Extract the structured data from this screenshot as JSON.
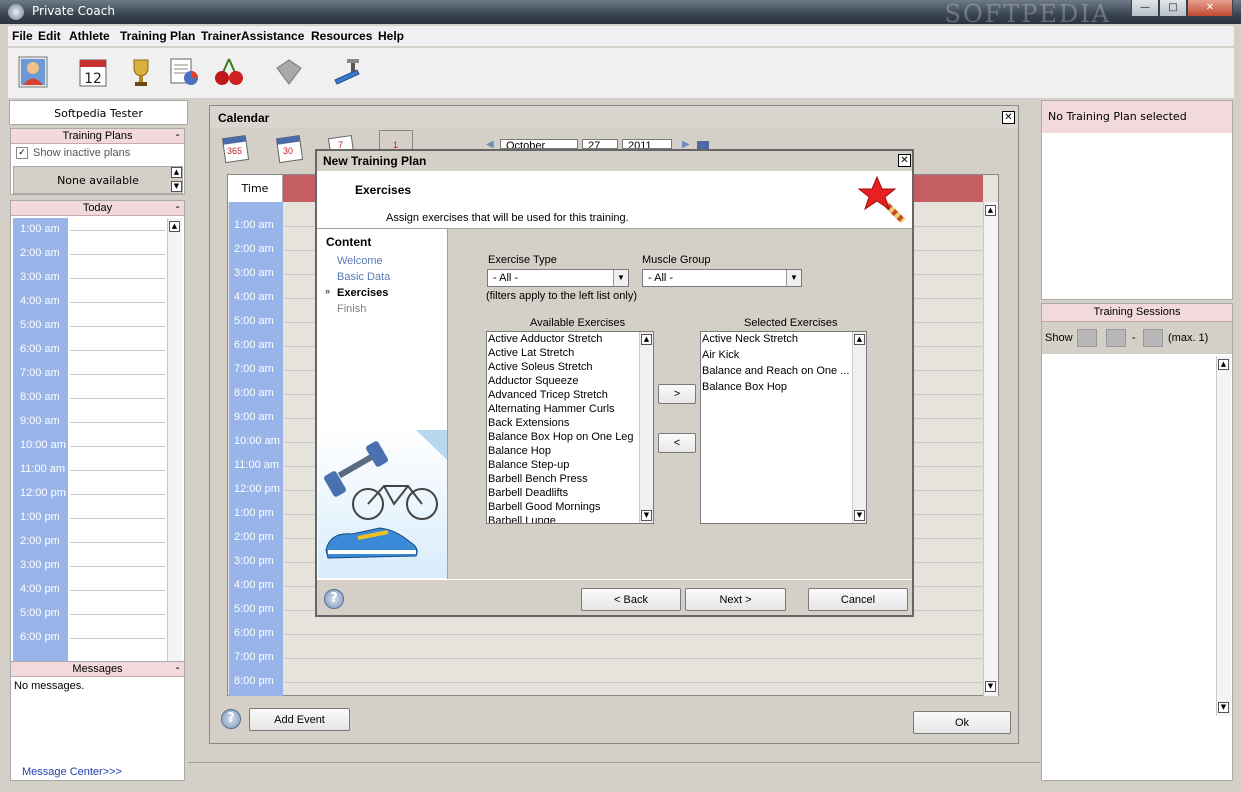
{
  "window": {
    "title": "Private Coach",
    "watermark": "SOFTPEDIA"
  },
  "menu": [
    "File",
    "Edit",
    "Athlete",
    "Training Plan",
    "TrainerAssistance",
    "Resources",
    "Help"
  ],
  "toolbar_icons": [
    "athlete-icon",
    "calendar-icon",
    "trophy-icon",
    "report-icon",
    "cherry-icon",
    "tag-icon",
    "treadmill-icon"
  ],
  "left": {
    "user": "Softpedia Tester",
    "training_plans": {
      "header": "Training Plans",
      "show_inactive": "Show inactive plans",
      "value": "None available"
    },
    "today": {
      "header": "Today",
      "hours": [
        "1:00 am",
        "2:00 am",
        "3:00 am",
        "4:00 am",
        "5:00 am",
        "6:00 am",
        "7:00 am",
        "8:00 am",
        "9:00 am",
        "10:00 am",
        "11:00 am",
        "12:00 pm",
        "1:00 pm",
        "2:00 pm",
        "3:00 pm",
        "4:00 pm",
        "5:00 pm",
        "6:00 pm"
      ]
    },
    "messages": {
      "header": "Messages",
      "text": "No messages.",
      "link": "Message Center>>>"
    }
  },
  "calendar": {
    "title": "Calendar",
    "view_icons": [
      "365",
      "30",
      "7",
      "1"
    ],
    "month": "October",
    "day": "27",
    "year": "2011",
    "time_header": "Time",
    "hours": [
      "1:00 am",
      "2:00 am",
      "3:00 am",
      "4:00 am",
      "5:00 am",
      "6:00 am",
      "7:00 am",
      "8:00 am",
      "9:00 am",
      "10:00 am",
      "11:00 am",
      "12:00 pm",
      "1:00 pm",
      "2:00 pm",
      "3:00 pm",
      "4:00 pm",
      "5:00 pm",
      "6:00 pm",
      "7:00 pm",
      "8:00 pm"
    ],
    "add_event": "Add Event",
    "ok": "Ok"
  },
  "dialog": {
    "title": "New Training Plan",
    "heading": "Exercises",
    "description": "Assign exercises that will be used for this training.",
    "content_header": "Content",
    "steps": [
      "Welcome",
      "Basic Data",
      "Exercises",
      "Finish"
    ],
    "exercise_type_label": "Exercise Type",
    "exercise_type_value": "- All -",
    "muscle_group_label": "Muscle Group",
    "muscle_group_value": "- All -",
    "filter_note": "(filters apply to the left list only)",
    "available_label": "Available Exercises",
    "available": [
      "Active Adductor Stretch",
      "Active Lat Stretch",
      "Active Soleus Stretch",
      "Adductor Squeeze",
      "Advanced Tricep Stretch",
      "Alternating Hammer Curls",
      "Back Extensions",
      "Balance Box Hop on One Leg",
      "Balance Hop",
      "Balance Step-up",
      "Barbell Bench Press",
      "Barbell Deadlifts",
      "Barbell Good Mornings",
      "Barbell Lunge"
    ],
    "selected_label": "Selected Exercises",
    "selected": [
      "Active Neck Stretch",
      "Air Kick",
      "Balance and Reach on One ...",
      "Balance Box Hop"
    ],
    "add_btn": ">",
    "remove_btn": "<",
    "back": "< Back",
    "next": "Next >",
    "cancel": "Cancel"
  },
  "right": {
    "plan_status": "No Training Plan selected",
    "sessions_header": "Training Sessions",
    "show_label": "Show",
    "dash": "-",
    "max_label": "(max. 1)"
  }
}
